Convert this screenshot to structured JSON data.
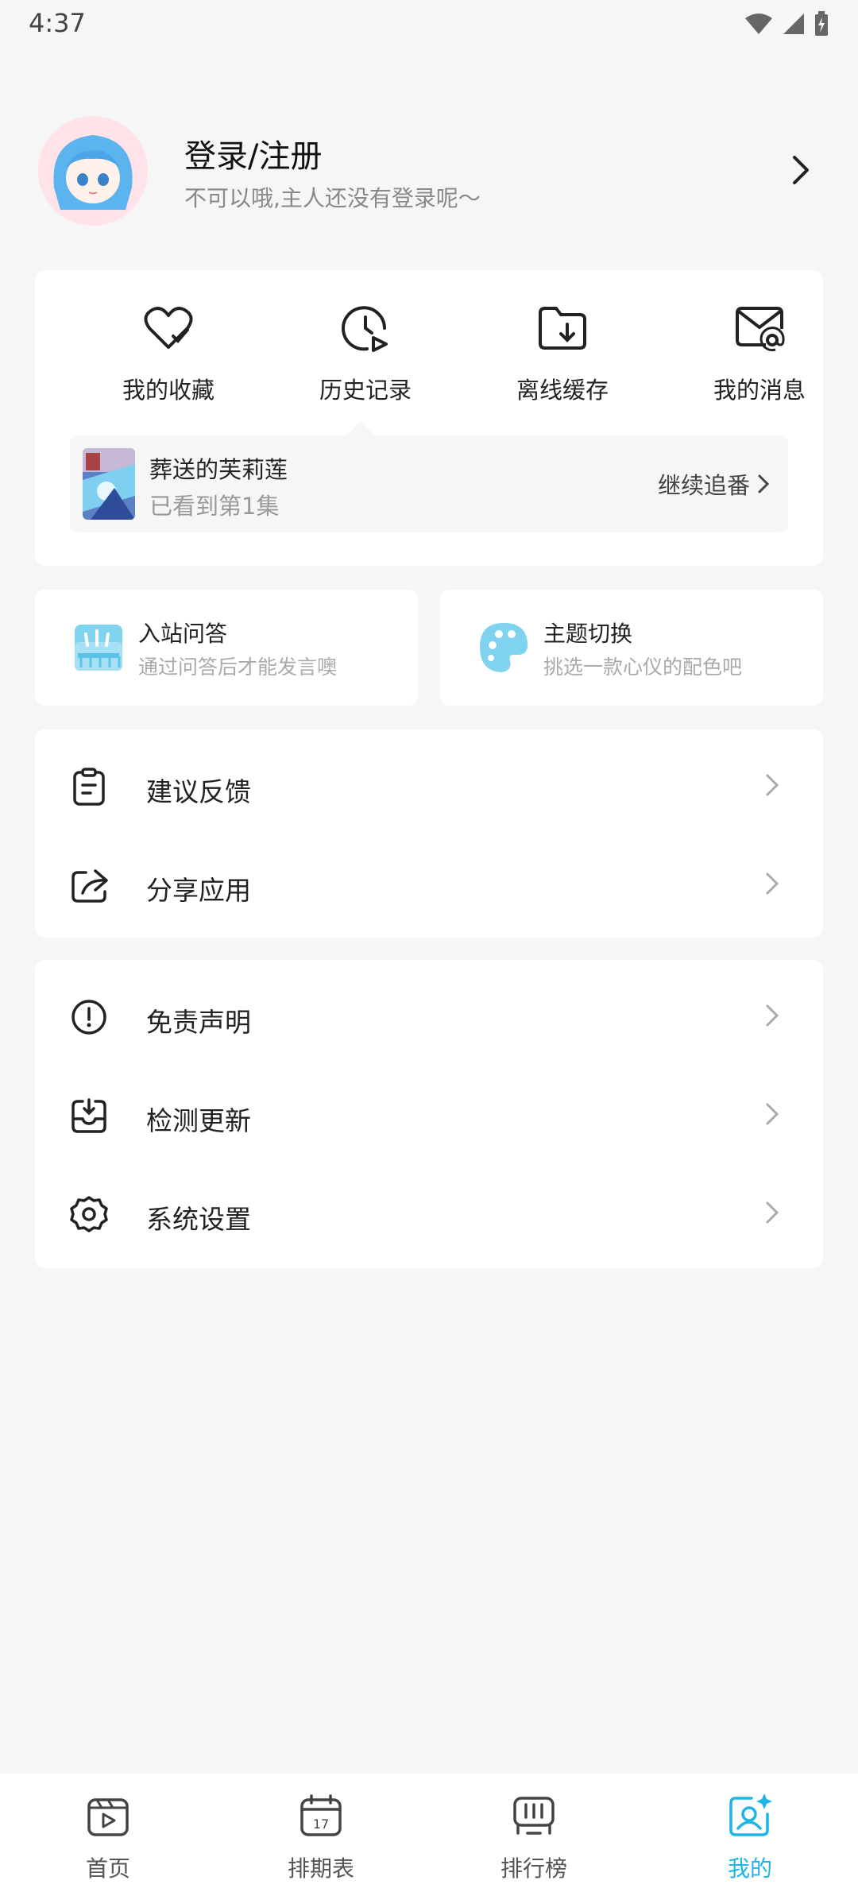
{
  "status_bar": {
    "time": "4:37"
  },
  "profile": {
    "title": "登录/注册",
    "subtitle": "不可以哦,主人还没有登录呢～"
  },
  "quick_actions": [
    {
      "label": "我的收藏",
      "icon": "heart-check-icon"
    },
    {
      "label": "历史记录",
      "icon": "clock-play-icon"
    },
    {
      "label": "离线缓存",
      "icon": "folder-download-icon"
    },
    {
      "label": "我的消息",
      "icon": "mail-at-icon"
    }
  ],
  "continue_watching": {
    "title": "葬送的芙莉莲",
    "progress": "已看到第1集",
    "action": "继续追番"
  },
  "mini_cards": [
    {
      "title": "入站问答",
      "subtitle": "通过问答后才能发言噢",
      "icon": "quiz-icon"
    },
    {
      "title": "主题切换",
      "subtitle": "挑选一款心仪的配色吧",
      "icon": "palette-icon"
    }
  ],
  "list_group_1": [
    {
      "label": "建议反馈",
      "icon": "clipboard-icon"
    },
    {
      "label": "分享应用",
      "icon": "share-icon"
    }
  ],
  "list_group_2": [
    {
      "label": "免责声明",
      "icon": "alert-circle-icon"
    },
    {
      "label": "检测更新",
      "icon": "inbox-download-icon"
    },
    {
      "label": "系统设置",
      "icon": "gear-icon"
    }
  ],
  "bottom_nav": [
    {
      "label": "首页",
      "icon": "home-play-icon"
    },
    {
      "label": "排期表",
      "icon": "calendar-icon"
    },
    {
      "label": "排行榜",
      "icon": "ranking-icon"
    },
    {
      "label": "我的",
      "icon": "user-star-icon",
      "active": true
    }
  ],
  "colors": {
    "accent": "#1eb4e6",
    "background": "#f6f6f7",
    "card": "#ffffff"
  }
}
